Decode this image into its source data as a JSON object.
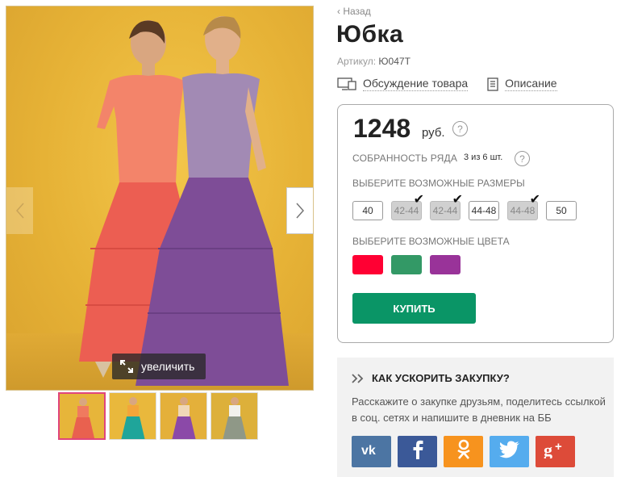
{
  "gallery": {
    "zoom_label": "увеличить",
    "thumbnails": [
      {
        "bg": "#e7b53a",
        "skirt": "#e9614f",
        "top": "#f07a5f"
      },
      {
        "bg": "#e9b83c",
        "skirt": "#1fa59a",
        "top": "#f3a53a"
      },
      {
        "bg": "#e4b03a",
        "skirt": "#8b49a8",
        "top": "#f0d7b8"
      },
      {
        "bg": "#ddb03a",
        "skirt": "#8f9887",
        "top": "#f2f1ec"
      }
    ]
  },
  "product": {
    "back_label": "Назад",
    "title": "Юбка",
    "sku_label": "Артикул:",
    "sku_value": "Ю047Т",
    "tabs": {
      "discussion": "Обсуждение товара",
      "description": "Описание"
    }
  },
  "buy_box": {
    "price": "1248",
    "currency": "руб.",
    "help_glyph": "?",
    "assembly_label": "СОБРАННОСТЬ РЯДА",
    "assembly_value": "3 из 6 шт.",
    "sizes_label": "ВЫБЕРИТЕ  ВОЗМОЖНЫЕ РАЗМЕРЫ",
    "sizes": [
      {
        "label": "40",
        "taken": false
      },
      {
        "label": "42-44",
        "taken": true
      },
      {
        "label": "42-44",
        "taken": true
      },
      {
        "label": "44-48",
        "taken": false
      },
      {
        "label": "44-48",
        "taken": true
      },
      {
        "label": "50",
        "taken": false
      }
    ],
    "colors_label": "ВЫБЕРИТЕ ВОЗМОЖНЫЕ ЦВЕТА",
    "colors": [
      "#ff0033",
      "#339966",
      "#993399"
    ],
    "buy_label": "КУПИТЬ"
  },
  "promo": {
    "title": "КАК УСКОРИТЬ ЗАКУПКУ?",
    "text": "Расскажите о закупке друзьям, поделитесь ссылкой в соц. сетях и напишите в дневник на ББ",
    "socials": [
      {
        "name": "vk",
        "icon": "vk-icon",
        "color": "#4c75a3",
        "glyph": "vk"
      },
      {
        "name": "facebook",
        "icon": "facebook-icon",
        "color": "#3b5998",
        "glyph": "f"
      },
      {
        "name": "odnoklassniki",
        "icon": "odnoklassniki-icon",
        "color": "#f7931e",
        "glyph": "ok"
      },
      {
        "name": "twitter",
        "icon": "twitter-icon",
        "color": "#55acee",
        "glyph": "tw"
      },
      {
        "name": "google-plus",
        "icon": "google-plus-icon",
        "color": "#dd4b39",
        "glyph": "g+"
      }
    ]
  }
}
